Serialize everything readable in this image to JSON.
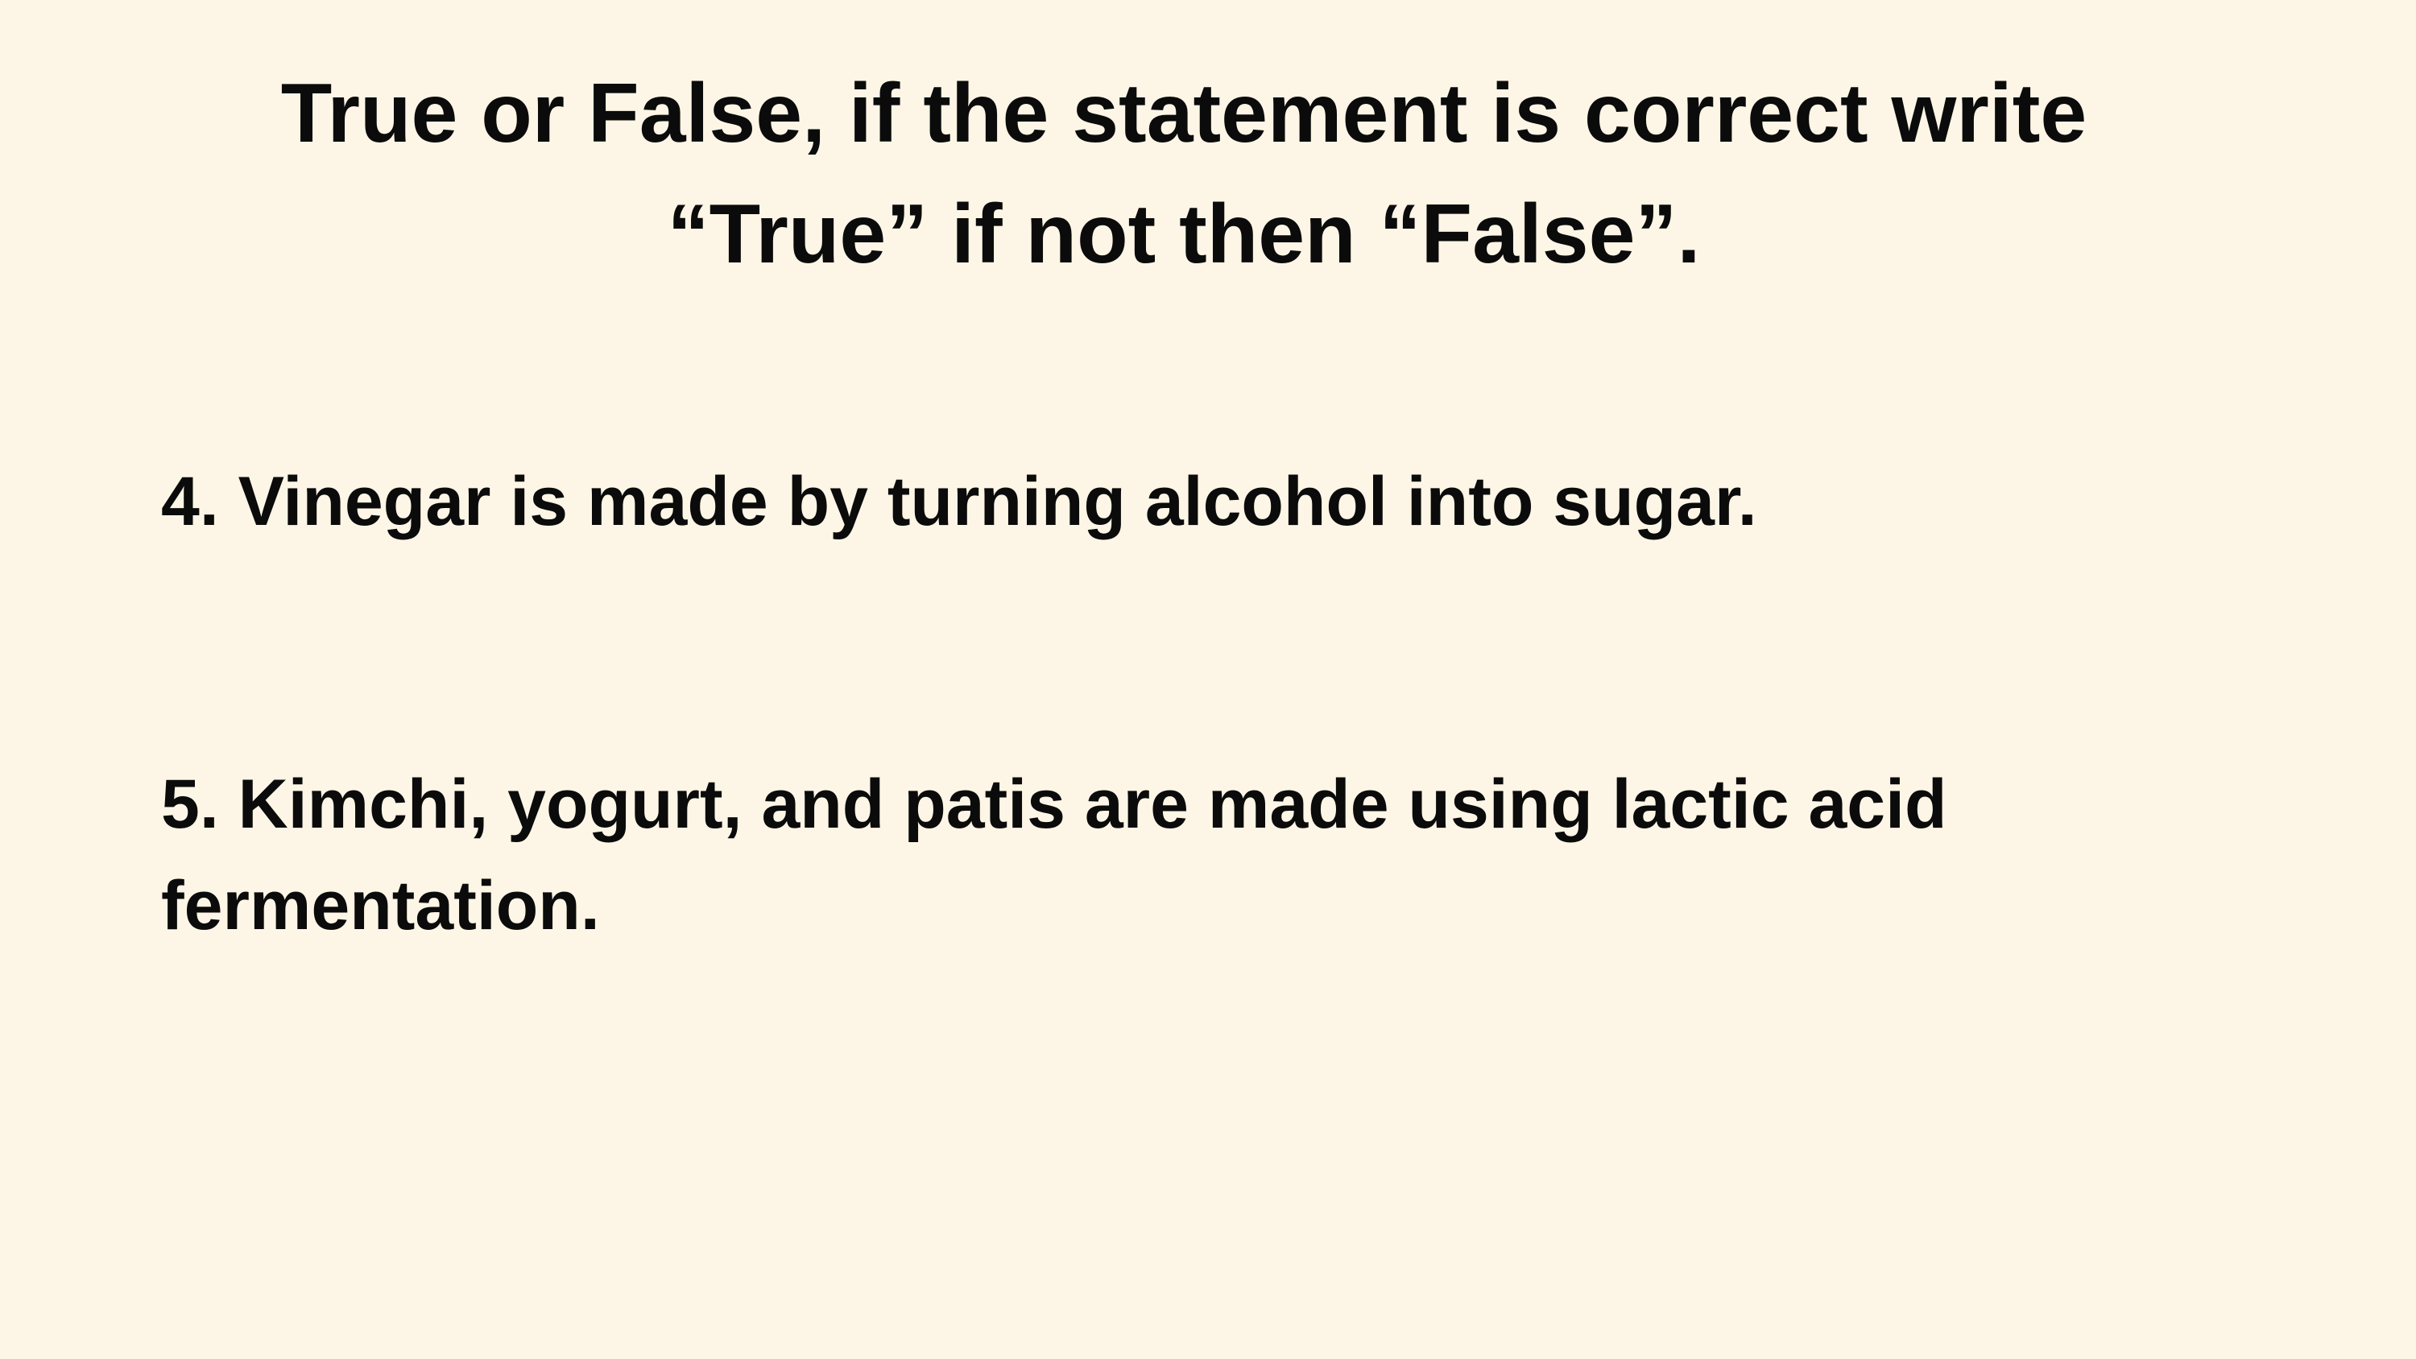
{
  "title": {
    "line1": "True or False, if the statement is correct write",
    "line2": "“True” if not then “False”."
  },
  "statements": [
    {
      "line1": "4. Vinegar is made by turning alcohol into sugar."
    },
    {
      "line1": "5. Kimchi, yogurt, and patis are made using lactic acid",
      "line2": "fermentation."
    }
  ],
  "colors": {
    "background": "#fdf6e6",
    "text": "#0b0b0b"
  }
}
